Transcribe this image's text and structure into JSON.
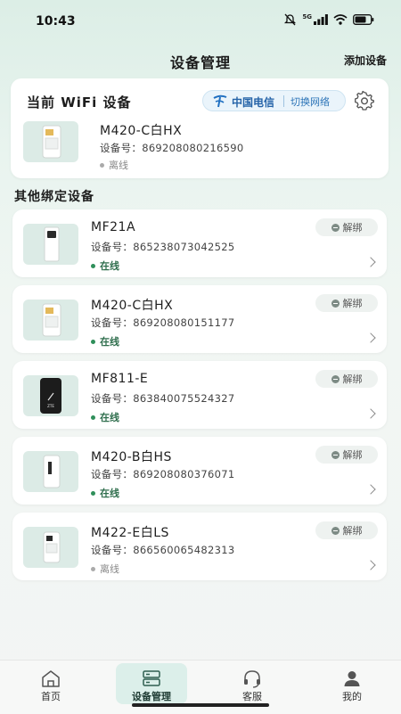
{
  "status_bar": {
    "time": "10:43",
    "network": "5G",
    "icons": [
      "mute-icon",
      "signal-icon",
      "wifi-icon",
      "battery-icon"
    ]
  },
  "header": {
    "title": "设备管理",
    "add_device": "添加设备"
  },
  "current": {
    "title": "当前 WiFi 设备",
    "carrier": "中国电信",
    "switch_network": "切换网络",
    "device": {
      "name": "M420-C白HX",
      "serial": "设备号：869208080216590",
      "status": "离线",
      "status_type": "offline"
    }
  },
  "section_title": "其他绑定设备",
  "unbind_label": "解绑",
  "devices": [
    {
      "name": "MF21A",
      "serial": "设备号：865238073042525",
      "status": "在线",
      "status_type": "online"
    },
    {
      "name": "M420-C白HX",
      "serial": "设备号：869208080151177",
      "status": "在线",
      "status_type": "online"
    },
    {
      "name": "MF811-E",
      "serial": "设备号：863840075524327",
      "status": "在线",
      "status_type": "online"
    },
    {
      "name": "M420-B白HS",
      "serial": "设备号：869208080376071",
      "status": "在线",
      "status_type": "online"
    },
    {
      "name": "M422-E白LS",
      "serial": "设备号：866560065482313",
      "status": "离线",
      "status_type": "offline"
    }
  ],
  "tabs": [
    {
      "label": "首页",
      "icon": "home-icon",
      "active": false
    },
    {
      "label": "设备管理",
      "icon": "device-manage-icon",
      "active": true
    },
    {
      "label": "客服",
      "icon": "headset-icon",
      "active": false
    },
    {
      "label": "我的",
      "icon": "user-icon",
      "active": false
    }
  ],
  "colors": {
    "accent": "#2f6e4d",
    "online": "#2f8f5a",
    "offline": "#aaaaaa",
    "carrier_blue": "#2563a8",
    "active_tab_bg": "#dcefea"
  }
}
